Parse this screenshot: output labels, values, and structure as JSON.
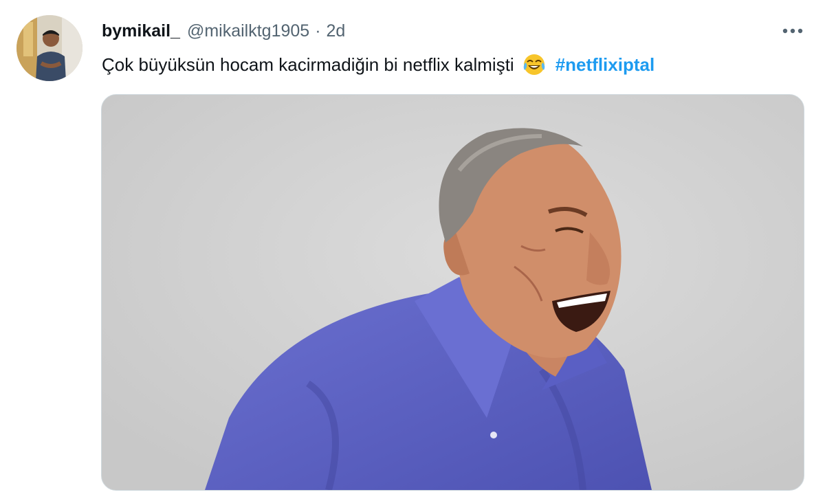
{
  "tweet": {
    "display_name": "bymikail_",
    "handle": "@mikailktg1905",
    "separator": "·",
    "time": "2d",
    "text": "Çok büyüksün hocam kacirmadiğin bi netflix kalmişti",
    "emoji": "face-with-tears-of-joy",
    "hashtag": "#netflixiptal"
  },
  "colors": {
    "text": "#0f1419",
    "secondary": "#536471",
    "link": "#1d9bf0",
    "shirt": "#5f64c4"
  },
  "icons": {
    "more": "more-horizontal-icon"
  }
}
